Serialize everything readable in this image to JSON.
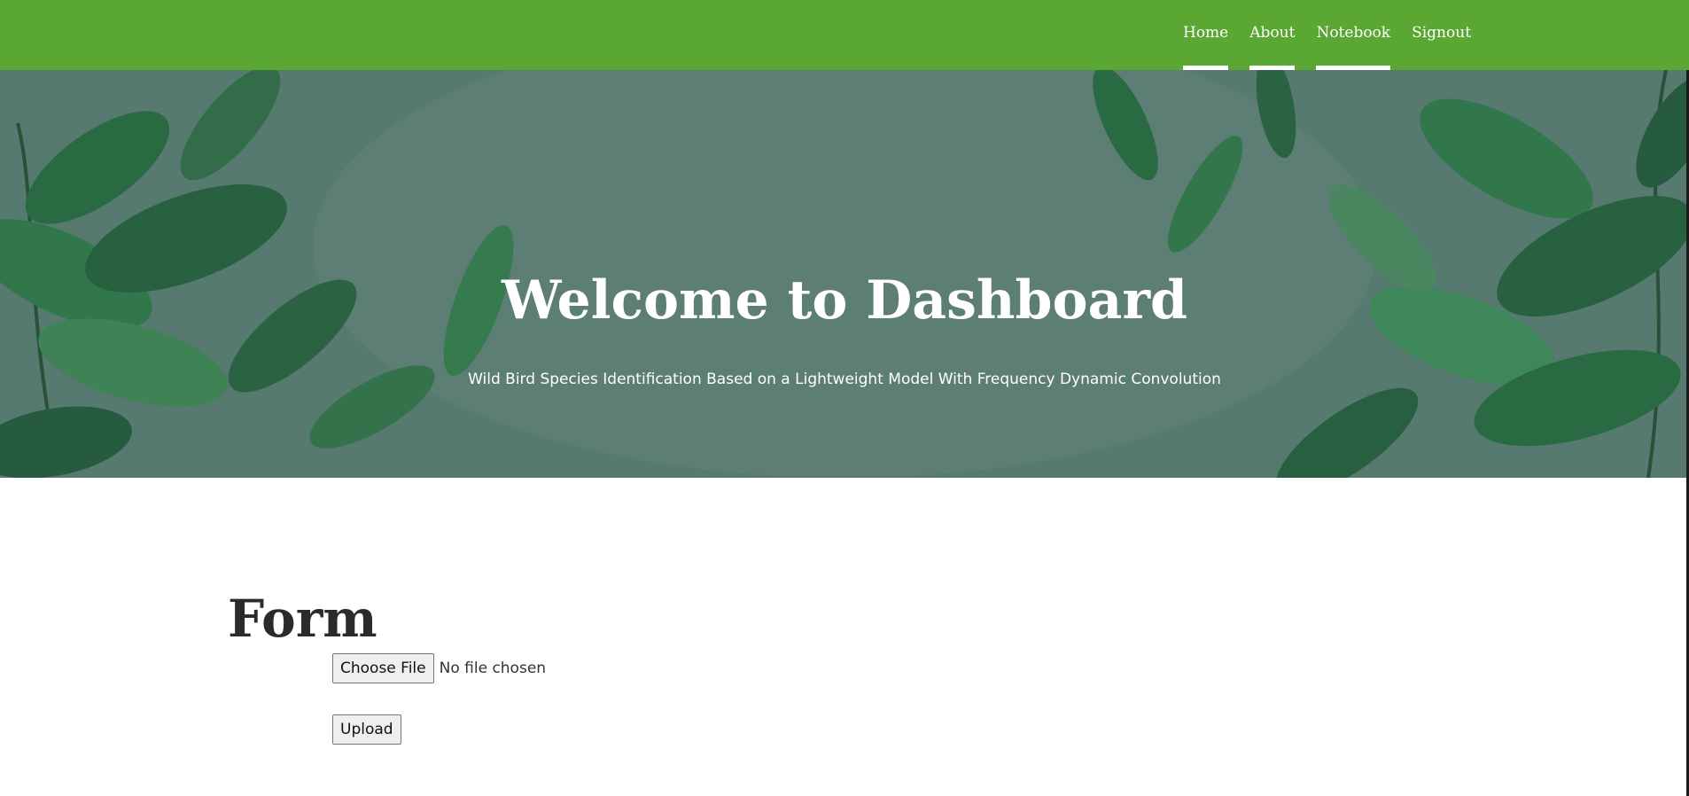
{
  "nav": {
    "items": [
      {
        "label": "Home"
      },
      {
        "label": "About"
      },
      {
        "label": "Notebook"
      },
      {
        "label": "Signout"
      }
    ],
    "background_color": "#5aa833"
  },
  "hero": {
    "title": "Welcome to Dashboard",
    "subtitle": "Wild Bird Species Identification Based on a Lightweight Model With Frequency Dynamic Convolution",
    "background": "leaf-pattern-image"
  },
  "form": {
    "heading": "Form",
    "choose_file_label": "Choose File",
    "file_status": "No file chosen",
    "upload_label": "Upload"
  }
}
